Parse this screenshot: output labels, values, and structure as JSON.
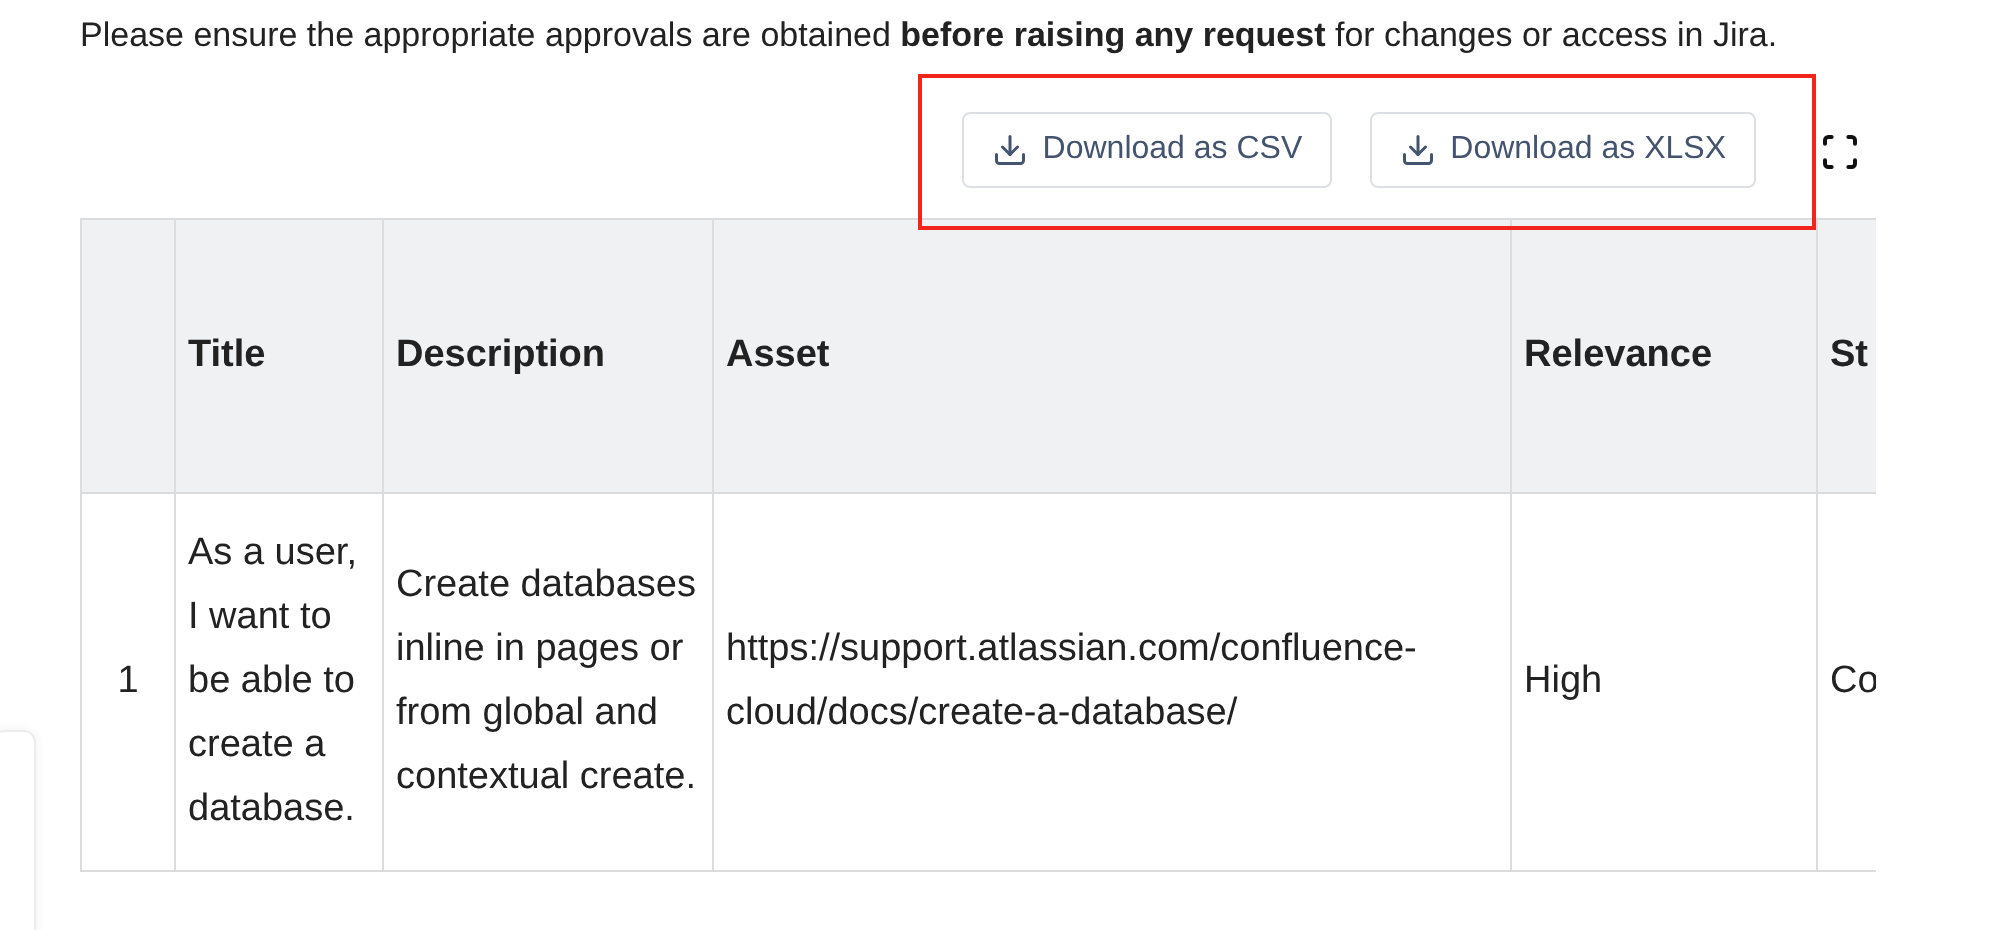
{
  "notice": "Please ensure the appropriate approvals are obtained **before raising any request** for changes or access in Jira.",
  "toolbar": {
    "buttons": [
      "Download as CSV",
      "Download as XLSX"
    ],
    "highlighted": true
  },
  "table": {
    "columns": [
      "",
      "Title",
      "Description",
      "Asset",
      "Relevance",
      "St"
    ],
    "rows": [
      [
        "1",
        "As a user, I want to be able to create a database.",
        "Create databases inline in pages or from global and contextual create.",
        "https://support.atlassian.com/confluence-cloud/docs/create-a-database/",
        "High",
        "Co"
      ]
    ]
  }
}
